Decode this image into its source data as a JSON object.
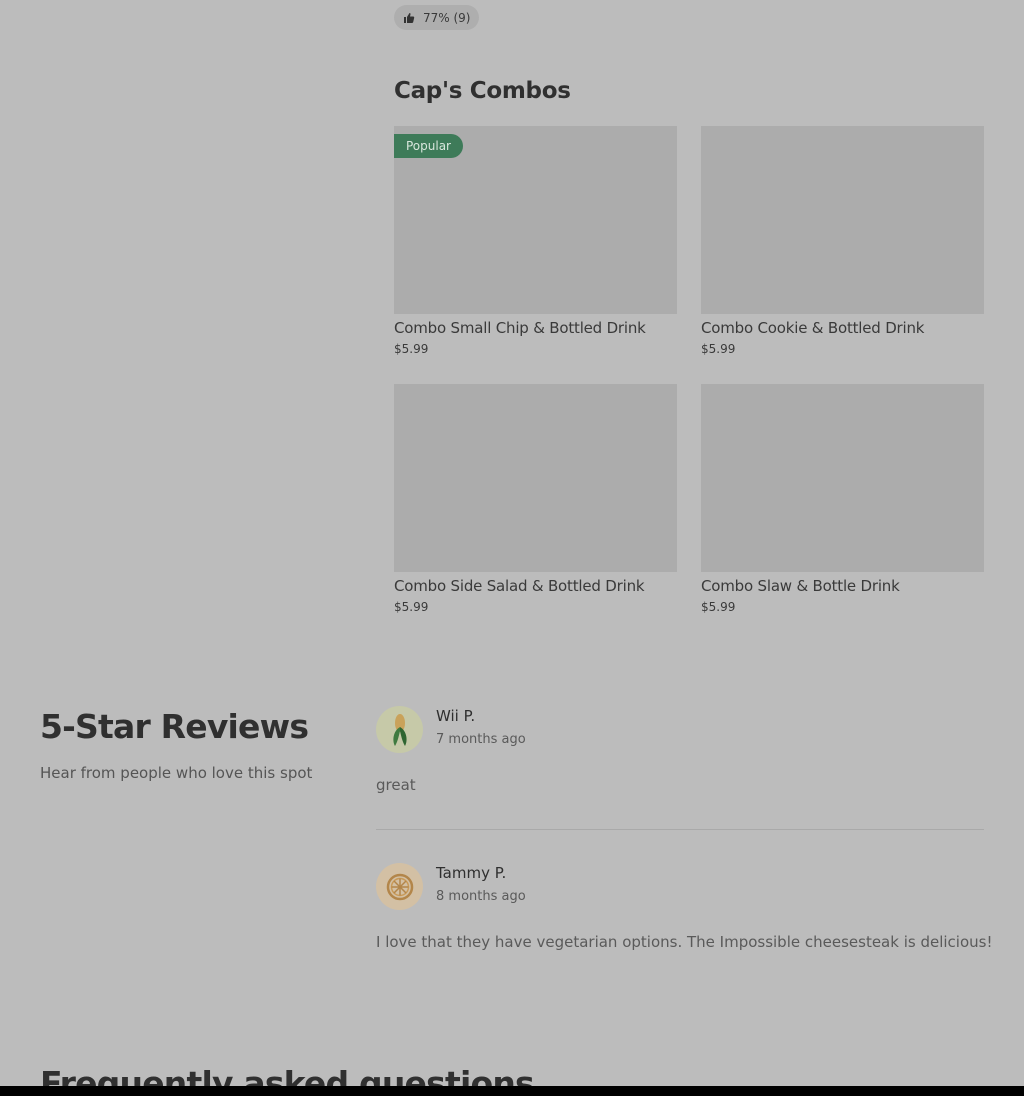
{
  "rating": {
    "icon": "thumbs-up-icon",
    "text": "77% (9)"
  },
  "combos": {
    "title": "Cap's Combos",
    "items": [
      {
        "name": "Combo Small Chip & Bottled Drink",
        "price": "$5.99",
        "badge": "Popular"
      },
      {
        "name": "Combo Cookie & Bottled Drink",
        "price": "$5.99",
        "badge": ""
      },
      {
        "name": "Combo Side Salad & Bottled Drink",
        "price": "$5.99",
        "badge": ""
      },
      {
        "name": "Combo Slaw & Bottle Drink",
        "price": "$5.99",
        "badge": ""
      }
    ]
  },
  "reviews": {
    "heading": "5-Star Reviews",
    "subheading": "Hear from people who love this spot",
    "items": [
      {
        "name": "Wii P.",
        "date": "7 months ago",
        "text": "great",
        "avatar_icon": "corn-icon",
        "avatar_color": "#c6c9a8"
      },
      {
        "name": "Tammy P.",
        "date": "8 months ago",
        "text": "I love that they have vegetarian options. The Impossible cheesesteak is delicious!",
        "avatar_icon": "citrus-slice-icon",
        "avatar_color": "#d3c0a4"
      }
    ]
  },
  "faq": {
    "heading": "Frequently asked questions"
  },
  "colors": {
    "popular_badge": "#3e7b59",
    "overlay_background": "#bcbcbc"
  }
}
